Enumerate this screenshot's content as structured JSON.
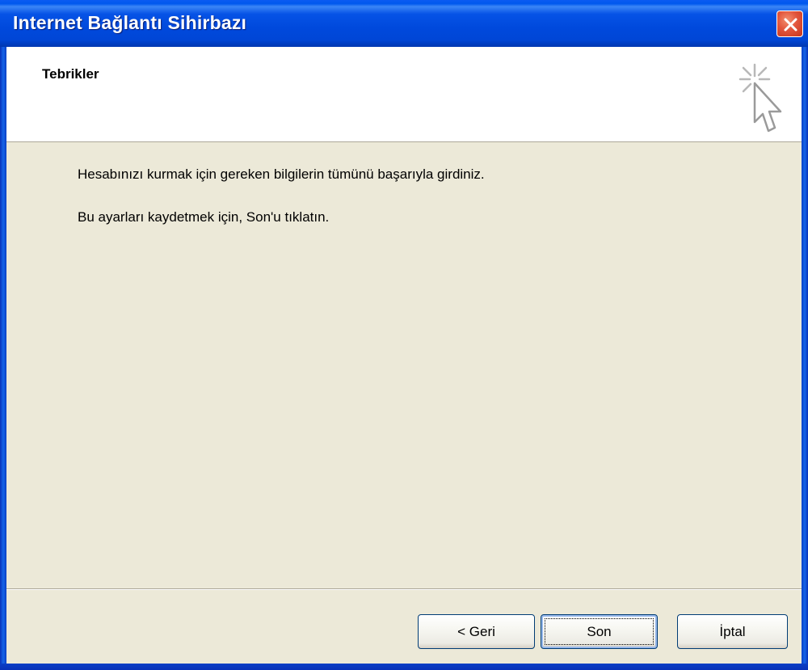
{
  "window": {
    "title": "Internet Bağlantı Sihirbazı",
    "close_icon": "close-icon"
  },
  "header": {
    "title": "Tebrikler",
    "icon": "wizard-cursor-icon"
  },
  "content": {
    "lines": [
      "Hesabınızı kurmak için gereken bilgilerin tümünü başarıyla girdiniz.",
      "Bu ayarları kaydetmek için, Son'u tıklatın."
    ]
  },
  "footer": {
    "back_label": "< Geri",
    "finish_label": "Son",
    "cancel_label": "İptal"
  },
  "colors": {
    "titlebar": "#0058ee",
    "dialog_bg": "#ece9d8",
    "close_button": "#e2553c"
  }
}
